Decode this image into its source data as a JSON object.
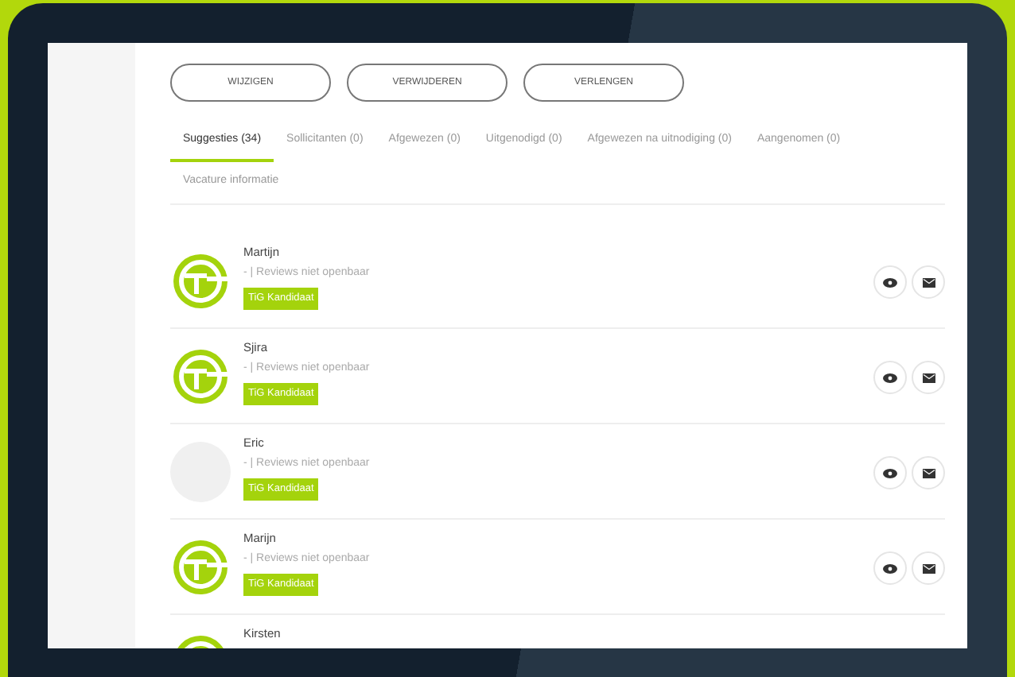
{
  "buttons": [
    "WIJZIGEN",
    "VERWIJDEREN",
    "VERLENGEN"
  ],
  "tabs": [
    {
      "label": "Suggesties (34)",
      "selected": true
    },
    {
      "label": "Sollicitanten (0)",
      "selected": false
    },
    {
      "label": "Afgewezen (0)",
      "selected": false
    },
    {
      "label": "Uitgenodigd (0)",
      "selected": false
    },
    {
      "label": "Afgewezen na uitnodiging (0)",
      "selected": false
    },
    {
      "label": "Aangenomen (0)",
      "selected": false
    },
    {
      "label": "Vacature informatie",
      "selected": false
    }
  ],
  "candidates": [
    {
      "name": "Martijn",
      "kind": "logo",
      "reviews": "- | Reviews niet openbaar",
      "badge": "TiG Kandidaat"
    },
    {
      "name": "Sjira",
      "kind": "logo",
      "reviews": "- | Reviews niet openbaar",
      "badge": "TiG Kandidaat"
    },
    {
      "name": "Eric",
      "kind": "blank",
      "reviews": "- | Reviews niet openbaar",
      "badge": "TiG Kandidaat"
    },
    {
      "name": "Marijn",
      "kind": "logo",
      "reviews": "- | Reviews niet openbaar",
      "badge": "TiG Kandidaat"
    },
    {
      "name": "Kirsten",
      "kind": "logo"
    }
  ]
}
